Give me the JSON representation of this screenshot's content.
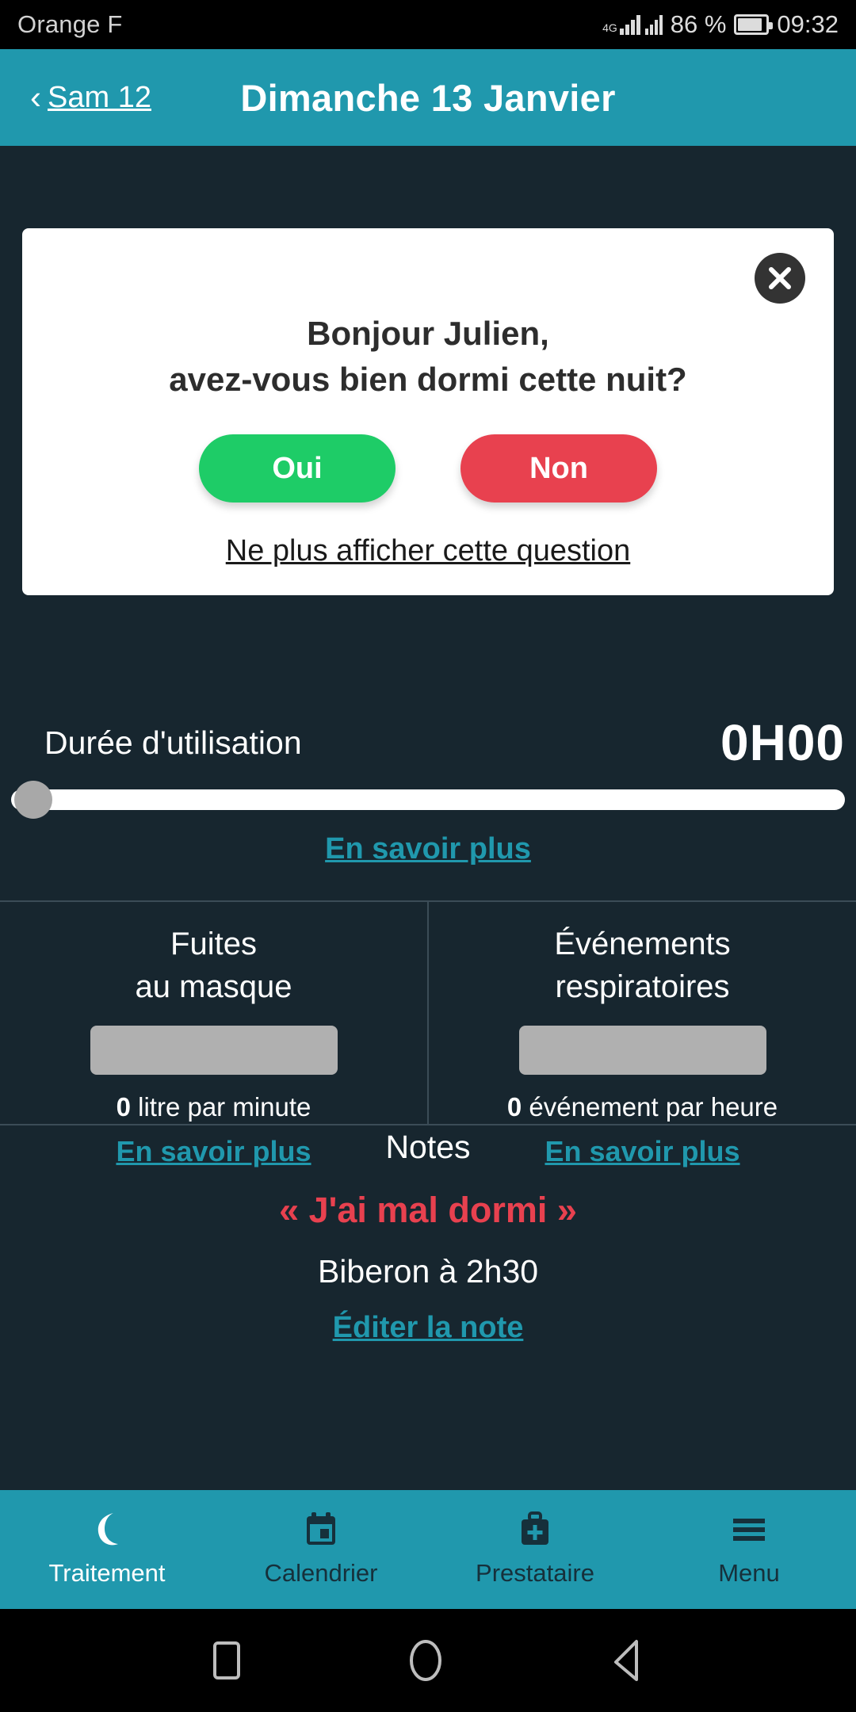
{
  "status_bar": {
    "carrier": "Orange F",
    "network": "4G",
    "battery_text": "86 %",
    "battery_level": 86,
    "clock": "09:32"
  },
  "header": {
    "back_chevron": "chevron-left",
    "back_label": "Sam 12",
    "title": "Dimanche 13 Janvier"
  },
  "modal": {
    "close_icon": "close-icon",
    "greeting_line1": "Bonjour Julien,",
    "greeting_line2": "avez-vous bien dormi cette nuit?",
    "yes_label": "Oui",
    "no_label": "Non",
    "dismiss_label": "Ne plus afficher cette question",
    "yes_color": "#1ecc67",
    "no_color": "#e8414f"
  },
  "duration": {
    "label": "Durée d'utilisation",
    "value": "0H00",
    "slider_percent": 0,
    "learn_more": "En savoir plus"
  },
  "metrics": [
    {
      "title_line1": "Fuites",
      "title_line2": "au masque",
      "value": "0",
      "unit": "litre par minute",
      "learn_more": "En savoir plus"
    },
    {
      "title_line1": "Événements",
      "title_line2": "respiratoires",
      "value": "0",
      "unit": "événement par heure",
      "learn_more": "En savoir plus"
    }
  ],
  "notes": {
    "title": "Notes",
    "quote": "« J'ai mal dormi »",
    "line": "Biberon à 2h30",
    "edit_label": "Éditer la note"
  },
  "bottom_nav": [
    {
      "label": "Traitement",
      "icon": "moon-icon",
      "active": true
    },
    {
      "label": "Calendrier",
      "icon": "calendar-icon",
      "active": false
    },
    {
      "label": "Prestataire",
      "icon": "medical-bag-icon",
      "active": false
    },
    {
      "label": "Menu",
      "icon": "hamburger-icon",
      "active": false
    }
  ],
  "system_nav": {
    "recents": "square-icon",
    "home": "circle-icon",
    "back": "triangle-back-icon"
  },
  "colors": {
    "teal": "#2098ad",
    "background": "#17262f",
    "accent_red": "#e8414f",
    "accent_green": "#1ecc67"
  }
}
